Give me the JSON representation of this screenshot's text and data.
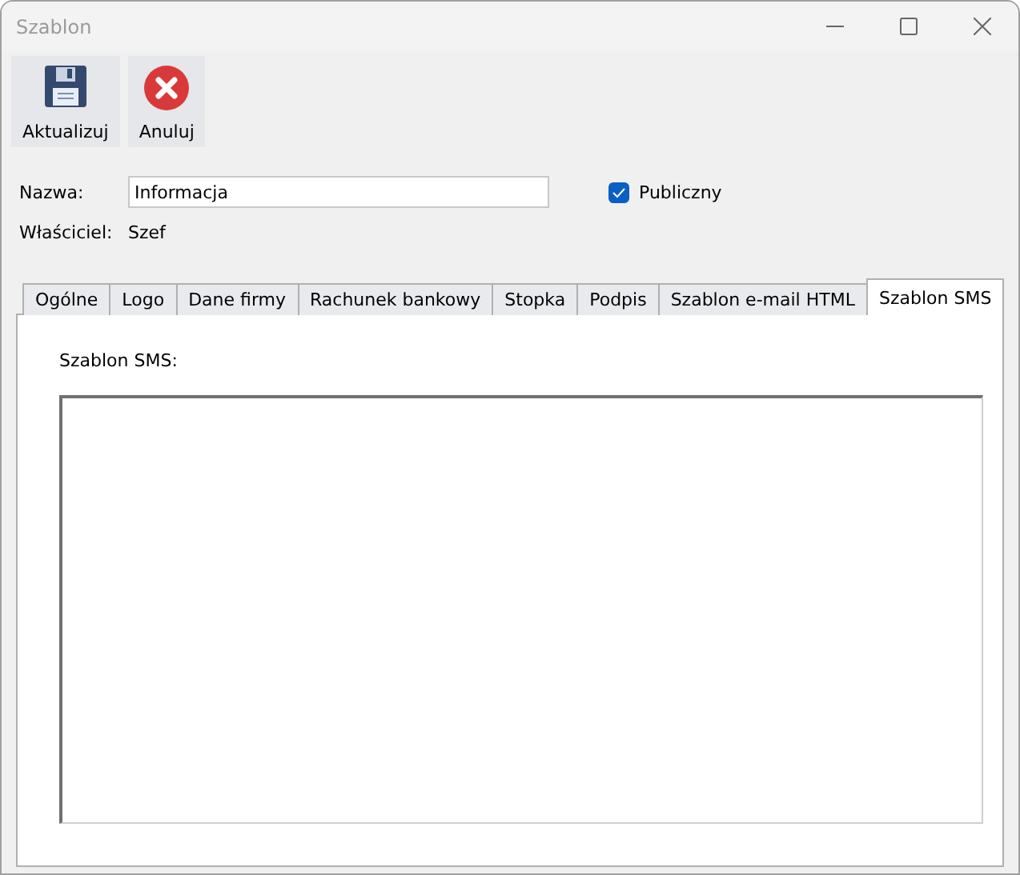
{
  "window": {
    "title": "Szablon"
  },
  "toolbar": [
    {
      "kind": "save",
      "label": "Aktualizuj"
    },
    {
      "kind": "cancel",
      "label": "Anuluj"
    }
  ],
  "name": {
    "label": "Nazwa:",
    "value": "Informacja"
  },
  "public": {
    "label": "Publiczny",
    "checked": true
  },
  "owner": {
    "label": "Właściciel:",
    "value": "Szef"
  },
  "tabs": [
    {
      "label": "Ogólne",
      "selected": false
    },
    {
      "label": "Logo",
      "selected": false
    },
    {
      "label": "Dane firmy",
      "selected": false
    },
    {
      "label": "Rachunek bankowy",
      "selected": false
    },
    {
      "label": "Stopka",
      "selected": false
    },
    {
      "label": "Podpis",
      "selected": false
    },
    {
      "label": "Szablon e-mail HTML",
      "selected": false
    },
    {
      "label": "Szablon SMS",
      "selected": true
    }
  ],
  "sms": {
    "label": "Szablon SMS:"
  }
}
